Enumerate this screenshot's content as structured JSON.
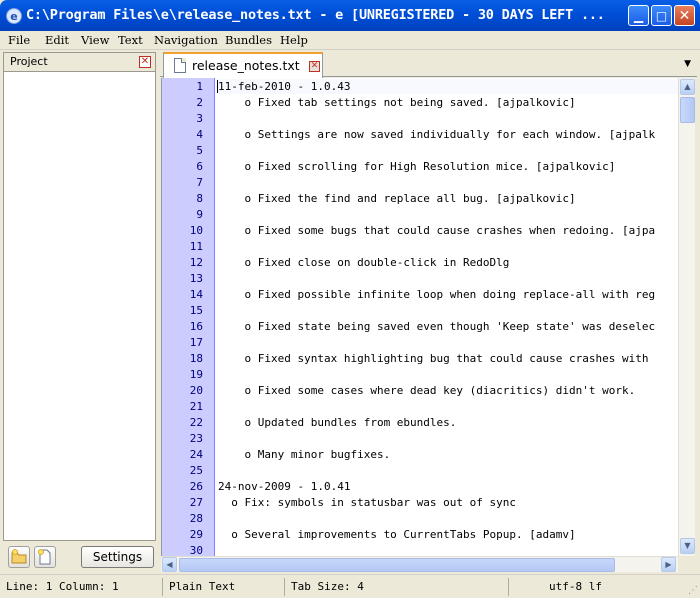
{
  "window": {
    "title": "C:\\Program Files\\e\\release_notes.txt - e  [UNREGISTERED - 30 DAYS LEFT ...",
    "icon": "e-app-icon",
    "minimize": "▁",
    "maximize": "□",
    "close": "✕"
  },
  "menu": [
    "File",
    "Edit",
    "View",
    "Text",
    "Navigation",
    "Bundles",
    "Help"
  ],
  "project_panel": {
    "title": "Project",
    "close": "✕",
    "settings_label": "Settings",
    "tool_icons": [
      "new-folder-icon",
      "new-file-icon"
    ]
  },
  "tabs": [
    {
      "label": "release_notes.txt",
      "close": "✕"
    }
  ],
  "tab_menu_arrow": "▼",
  "editor": {
    "line_numbers": [
      "1",
      "2",
      "3",
      "4",
      "5",
      "6",
      "7",
      "8",
      "9",
      "10",
      "11",
      "12",
      "13",
      "14",
      "15",
      "16",
      "17",
      "18",
      "19",
      "20",
      "21",
      "22",
      "23",
      "24",
      "25",
      "26",
      "27",
      "28",
      "29",
      "30"
    ],
    "lines": [
      "11-feb-2010 - 1.0.43",
      "    o Fixed tab settings not being saved. [ajpalkovic]",
      "",
      "    o Settings are now saved individually for each window. [ajpalk",
      "",
      "    o Fixed scrolling for High Resolution mice. [ajpalkovic]",
      "",
      "    o Fixed the find and replace all bug. [ajpalkovic]",
      "",
      "    o Fixed some bugs that could cause crashes when redoing. [ajpa",
      "",
      "    o Fixed close on double-click in RedoDlg",
      "",
      "    o Fixed possible infinite loop when doing replace-all with reg",
      "",
      "    o Fixed state being saved even though 'Keep state' was deselec",
      "",
      "    o Fixed syntax highlighting bug that could cause crashes with",
      "",
      "    o Fixed some cases where dead key (diacritics) didn't work.",
      "",
      "    o Updated bundles from ebundles.",
      "",
      "    o Many minor bugfixes.",
      "",
      "24-nov-2009 - 1.0.41",
      "  o Fix: symbols in statusbar was out of sync",
      "",
      "  o Several improvements to CurrentTabs Popup. [adamv]",
      ""
    ]
  },
  "scrollbar": {
    "up": "▲",
    "down": "▼",
    "left": "◀",
    "right": "▶"
  },
  "status": {
    "line": "Line: 1",
    "column": "Column: 1",
    "syntax": "Plain Text",
    "tab_size": "Tab Size: 4",
    "encoding": "utf-8 lf"
  },
  "colors": {
    "titlebar": "#0050d8",
    "gutter": "#ccccff",
    "line_numbers": "#000080"
  }
}
